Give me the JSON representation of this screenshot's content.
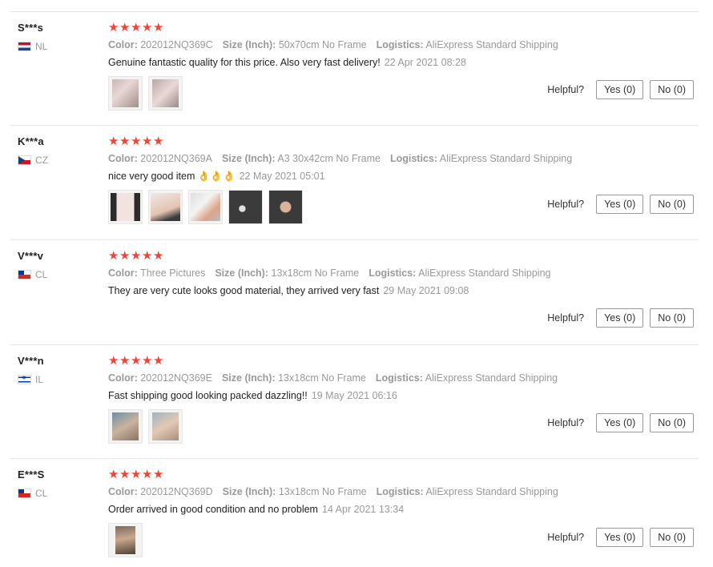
{
  "labels": {
    "color": "Color:",
    "size": "Size (Inch):",
    "logistics": "Logistics:",
    "helpful": "Helpful?"
  },
  "colors": {
    "star": "#f44336",
    "divider": "#e8e8e8",
    "muted": "#999999"
  },
  "reviews": [
    {
      "user": "S***s",
      "country": "NL",
      "flag_icon": "netherlands-flag-icon",
      "stars": 5,
      "color": "202012NQ369C",
      "size": "50x70cm No Frame",
      "logistics": "AliExpress Standard Shipping",
      "text": "Genuine fantastic quality for this price. Also very fast delivery!",
      "date": "22 Apr 2021 08:28",
      "photos": 2,
      "yes": "Yes (0)",
      "no": "No (0)"
    },
    {
      "user": "K***a",
      "country": "CZ",
      "flag_icon": "czech-flag-icon",
      "stars": 5,
      "color": "202012NQ369A",
      "size": "A3 30x42cm No Frame",
      "logistics": "AliExpress Standard Shipping",
      "text": "nice very good item 👌👌👌",
      "date": "22 May 2021 05:01",
      "photos": 5,
      "yes": "Yes (0)",
      "no": "No (0)"
    },
    {
      "user": "V***v",
      "country": "CL",
      "flag_icon": "chile-flag-icon",
      "stars": 5,
      "color": "Three Pictures",
      "size": "13x18cm No Frame",
      "logistics": "AliExpress Standard Shipping",
      "text": "They are very cute looks good material, they arrived very fast",
      "date": "29 May 2021 09:08",
      "photos": 0,
      "yes": "Yes (0)",
      "no": "No (0)"
    },
    {
      "user": "V***n",
      "country": "IL",
      "flag_icon": "israel-flag-icon",
      "stars": 5,
      "color": "202012NQ369E",
      "size": "13x18cm No Frame",
      "logistics": "AliExpress Standard Shipping",
      "text": "Fast shipping good looking packed dazzling!!",
      "date": "19 May 2021 06:16",
      "photos": 2,
      "yes": "Yes (0)",
      "no": "No (0)"
    },
    {
      "user": "E***S",
      "country": "CL",
      "flag_icon": "chile-flag-icon",
      "stars": 5,
      "color": "202012NQ369D",
      "size": "13x18cm No Frame",
      "logistics": "AliExpress Standard Shipping",
      "text": "Order arrived in good condition and no problem",
      "date": "14 Apr 2021 13:34",
      "photos": 1,
      "yes": "Yes (0)",
      "no": "No (0)"
    }
  ]
}
